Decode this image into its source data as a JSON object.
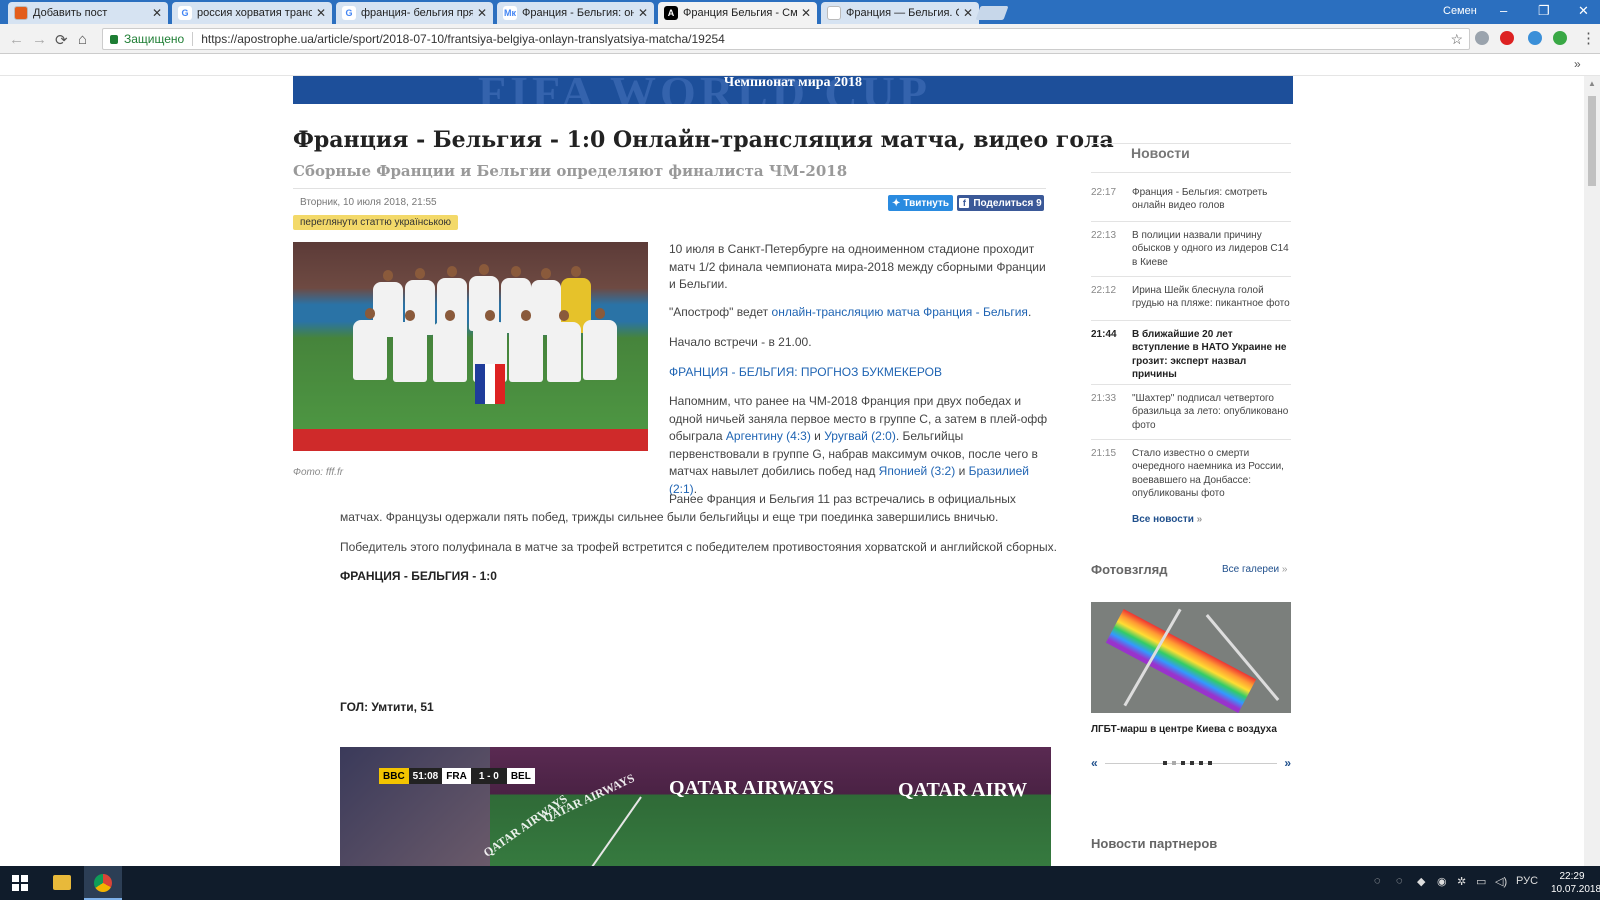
{
  "tabs": [
    {
      "title": "Добавить пост",
      "fav": "#e35d1b",
      "glyph": ""
    },
    {
      "title": "россия хорватия трансл",
      "fav": "#fff",
      "glyph": "G"
    },
    {
      "title": "франция- бельгия прям",
      "fav": "#fff",
      "glyph": "G"
    },
    {
      "title": "Франция - Бельгия: онл",
      "fav": "#fff",
      "glyph": "Мк"
    },
    {
      "title": "Франция Бельгия - Смо",
      "fav": "#000",
      "glyph": "А"
    },
    {
      "title": "Франция — Бельгия. Он",
      "fav": "#fff",
      "glyph": ""
    }
  ],
  "window": {
    "user": "Семен"
  },
  "address": {
    "secure": "Защищено",
    "url": "https://apostrophe.ua/article/sport/2018-07-10/frantsiya-belgiya-onlayn-translyatsiya-matcha/19254"
  },
  "banner": {
    "text": "Чемпионат мира 2018",
    "bg_word": "FIFA WORLD CUP"
  },
  "article": {
    "title": "Франция - Бельгия - 1:0 Онлайн-трансляция матча, видео гола",
    "subtitle": "Сборные Франции и Бельгии определяют финалиста ЧМ-2018",
    "date": "Вторник, 10 июля 2018, 21:55",
    "tweet": "Твитнуть",
    "share": "Поделиться 9",
    "ukr": "переглянути статтю українською",
    "photo_caption": "Фото: fff.fr",
    "p1": "10 июля в Санкт-Петербурге на одноименном стадионе проходит матч 1/2 финала чемпионата мира-2018 между сборными Франции и Бельгии.",
    "p2_a": "\"Апостроф\" ведет ",
    "p2_link": "онлайн-трансляцию матча Франция - Бельгия",
    "p2_b": ".",
    "p3": "Начало встречи - в 21.00.",
    "p4_link": "ФРАНЦИЯ - БЕЛЬГИЯ: ПРОГНОЗ БУКМЕКЕРОВ",
    "p5_a": "Напомним, что ранее на ЧМ-2018 Франция при двух победах и одной ничьей заняла первое место в группе С, а затем в плей-офф обыграла ",
    "p5_l1": "Аргентину (4:3)",
    "p5_b": " и ",
    "p5_l2": "Уругвай (2:0)",
    "p5_c": ". Бельгийцы первенствовали в группе G, набрав максимум очков, после чего в матчах навылет добились побед над ",
    "p5_l3": "Японией (3:2)",
    "p5_d": " и ",
    "p5_l4": "Бразилией (2:1)",
    "p5_e": ".",
    "p6_l1": "Ранее Франция и Бельгия 11 раз встречались в официальных",
    "p6_l2": "матчах. Французы одержали пять побед, трижды сильнее были бельгийцы и еще три поединка завершились вничью.",
    "p7": "Победитель этого полуфинала в матче за трофей встретится с победителем противостояния хорватской и английской сборных.",
    "score_heading": "ФРАНЦИЯ - БЕЛЬГИЯ - 1:0",
    "goal": "ГОЛ: Умтити, 51"
  },
  "video": {
    "channel": "BBC",
    "time": "51:08",
    "home": "FRA",
    "score": "1 - 0",
    "away": "BEL",
    "ad1": "QATAR AIRWAYS",
    "ad2": "QATAR AIRW",
    "ad3": "QATAR AIRWAYS"
  },
  "sidebar": {
    "news_title": "Новости",
    "news": [
      {
        "time": "22:17",
        "text": "Франция - Бельгия: смотреть онлайн видео голов",
        "hot": false
      },
      {
        "time": "22:13",
        "text": "В полиции назвали причину обысков у одного из лидеров С14 в Киеве",
        "hot": false
      },
      {
        "time": "22:12",
        "text": "Ирина Шейк блеснула голой грудью на пляже: пикантное фото",
        "hot": false
      },
      {
        "time": "21:44",
        "text": "В ближайшие 20 лет вступление в НАТО Украине не грозит: эксперт назвал причины",
        "hot": true
      },
      {
        "time": "21:33",
        "text": "\"Шахтер\" подписал четвертого бразильца за лето: опубликовано фото",
        "hot": false
      },
      {
        "time": "21:15",
        "text": "Стало известно о смерти очередного наемника из России, воевавшего на Донбассе: опубликованы фото",
        "hot": false
      }
    ],
    "all_news": "Все новости",
    "foto_title": "Фотовзгляд",
    "all_gal": "Все галереи",
    "gal_caption": "ЛГБТ-марш в центре Киева с воздуха",
    "prev": "«",
    "next": "»",
    "partners": "Новости партнеров"
  },
  "taskbar": {
    "lang": "РУС",
    "time": "22:29",
    "date": "10.07.2018"
  }
}
